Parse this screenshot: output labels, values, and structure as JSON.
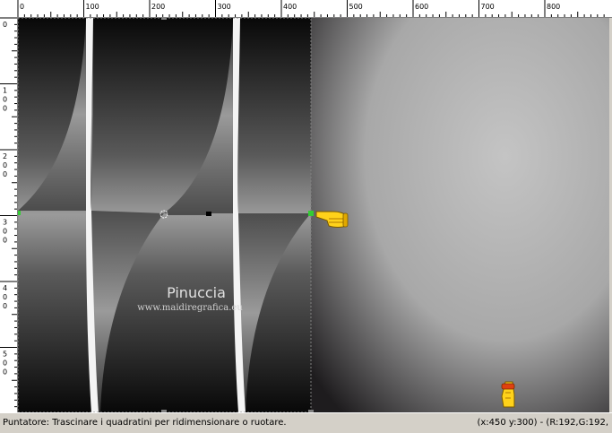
{
  "ruler": {
    "horizontal_labels": [
      "0",
      "100",
      "200",
      "300",
      "400",
      "500",
      "600",
      "700",
      "800"
    ],
    "vertical_labels": [
      "0",
      "100",
      "200",
      "300",
      "400",
      "500"
    ]
  },
  "canvas": {
    "background_left": "#0c0c0c",
    "background_right": "#c0c0c0",
    "highlight_color": "#33cc33",
    "watermark_title": "Pinuccia",
    "watermark_url": "www.maidiregrafica.eu"
  },
  "status": {
    "hint": "Puntatore: Trascinare i quadratini per ridimensionare o ruotare.",
    "coords": "(x:450 y:300) - (R:192,G:192,"
  },
  "icons": [
    "hand-pointer-icon",
    "hand-pointer-icon"
  ]
}
